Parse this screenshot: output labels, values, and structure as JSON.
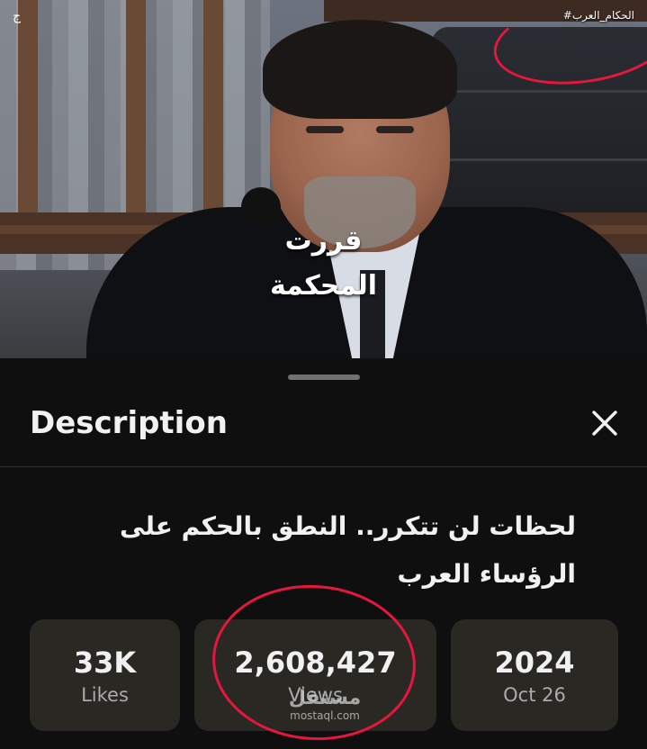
{
  "video": {
    "overlay_line1": "قررت",
    "overlay_line2": "المحكمة",
    "hashtag": "#الحكام_العرب",
    "corner_mark": "ج"
  },
  "sheet": {
    "title": "Description",
    "close_icon": "close-icon"
  },
  "description": {
    "title": "لحظات لن تتكرر.. النطق بالحكم على الرؤساء العرب"
  },
  "stats": {
    "likes_value": "33K",
    "likes_label": "Likes",
    "views_value": "2,608,427",
    "views_label": "Views",
    "date_value": "2024",
    "date_label": "Oct 26"
  },
  "watermark": {
    "arabic": "مستقل",
    "latin": "mostaql.com"
  },
  "colors": {
    "background": "#0f0f0f",
    "stat_card": "#2a2823",
    "annotation_red": "#e5173f",
    "secondary_text": "#aaaaaa"
  }
}
